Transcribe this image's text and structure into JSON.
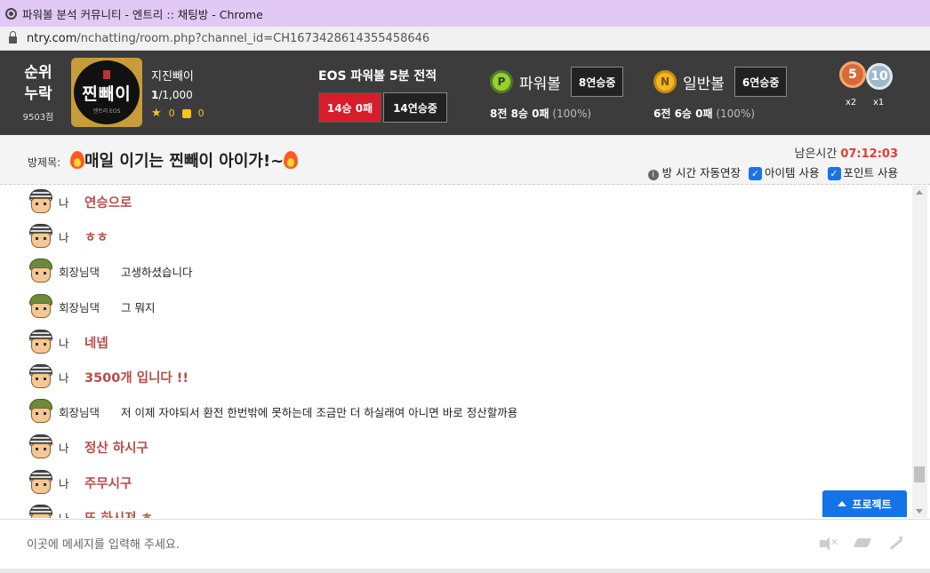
{
  "browser": {
    "title": "파워볼 분석 커뮤니티 - 엔트리 :: 채팅방 - Chrome",
    "url_host": "ntry.com",
    "url_path": "/nchatting/room.php?channel_id=CH1673428614355458646"
  },
  "rank": {
    "line1": "순위",
    "line2": "누락",
    "points": "9503점"
  },
  "profile": {
    "avatar_text": "찐빼이",
    "avatar_sub": "엔트리 EOS",
    "username": "지진빼이",
    "rank_current": "1",
    "rank_total": "/1,000",
    "stars": "0",
    "likes": "0"
  },
  "eos": {
    "title": "EOS 파워볼 5분 전적",
    "record": "14승 0패",
    "streak": "14연승중"
  },
  "powerball": {
    "icon": "P",
    "name": "파워볼",
    "streak": "8연승중",
    "record_pre": "8전 8승 0패",
    "pct": "(100%)"
  },
  "normalball": {
    "icon": "N",
    "name": "일반볼",
    "streak": "6연승중",
    "record_pre": "6전 6승 0패",
    "pct": "(100%)"
  },
  "medals": [
    {
      "icon": "bronze-medal-icon",
      "value": "5",
      "count": "x2"
    },
    {
      "icon": "silver-medal-icon",
      "value": "10",
      "count": "x1"
    }
  ],
  "room": {
    "label": "방제목:",
    "title": "매일 이기는 찐빼이 아이가!~",
    "time_label": "남은시간",
    "time_value": "07:12:03",
    "opt_extend": "방 시간 자동연장",
    "opt_item": "아이템 사용",
    "opt_point": "포인트 사용"
  },
  "messages": [
    {
      "who": "나",
      "text": "연승으로",
      "me": true
    },
    {
      "who": "나",
      "text": "ㅎㅎ",
      "me": true
    },
    {
      "who": "회장님댁",
      "text": "고생하셨습니다",
      "me": false
    },
    {
      "who": "회장님댁",
      "text": "그 뭐지",
      "me": false
    },
    {
      "who": "나",
      "text": "네넵",
      "me": true
    },
    {
      "who": "나",
      "text": "3500개 입니다 !!",
      "me": true
    },
    {
      "who": "회장님댁",
      "text": "저 이제 자야되서 환전 한번밖에 못하는데 조금만 더 하실래여 아니면 바로 정산할까용",
      "me": false
    },
    {
      "who": "나",
      "text": "정산 하시구",
      "me": true
    },
    {
      "who": "나",
      "text": "주무시구",
      "me": true
    },
    {
      "who": "나",
      "text": "또 하시져 ㅎ",
      "me": true
    }
  ],
  "protect_button": "프로젝트",
  "input": {
    "placeholder": "이곳에 메세지를 입력해 주세요."
  },
  "colors": {
    "title_bar": "#e2c8f5",
    "top_bar": "#3c3c3c",
    "my_text": "#b94a48",
    "time_red": "#e23b3b",
    "accent_blue": "#1473e6"
  }
}
